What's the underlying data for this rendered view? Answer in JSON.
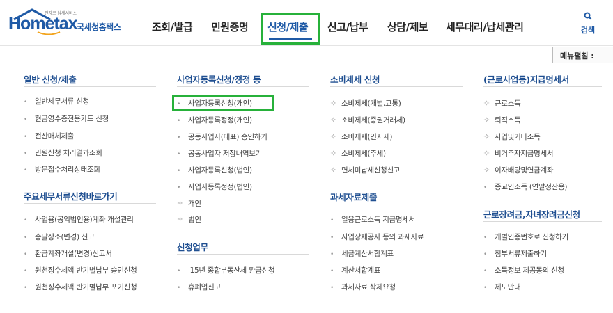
{
  "logo": {
    "tagline": "전자로 납세서비스",
    "main": "Hometax",
    "sub": "국세청홈택스"
  },
  "nav": {
    "items": [
      "조회/발급",
      "민원증명",
      "신청/제출",
      "신고/납부",
      "상담/제보",
      "세무대리/납세관리"
    ],
    "active": "신청/제출",
    "search_label": "검색"
  },
  "menu_collapse_label": "메뉴펼침 :",
  "sections": {
    "general": {
      "title": "일반 신청/제출",
      "items": [
        "일반세무서류 신청",
        "현금영수증전용카드 신청",
        "전산매체제출",
        "민원신청 처리결과조회",
        "방문접수처리상태조회"
      ]
    },
    "major_docs": {
      "title": "주요세무서류신청바로가기",
      "items": [
        "사업용(공익법인용)계좌 개설관리",
        "송달장소(변경) 신고",
        "환급계좌개설(변경)신고서",
        "원천징수세액 반기별납부 승인신청",
        "원천징수세액 반기별납부 포기신청"
      ]
    },
    "biz_reg": {
      "title": "사업자등록신청/정정 등",
      "items": [
        "사업자등록신청(개인)",
        "사업자등록정정(개인)",
        "공동사업자(대표) 승인하기",
        "공동사업자 저장내역보기",
        "사업자등록신청(법인)",
        "사업자등록정정(법인)",
        "개인",
        "법인"
      ]
    },
    "apply_work": {
      "title": "신청업무",
      "items": [
        "'15년 종합부동산세 환급신청",
        "휴폐업신고"
      ]
    },
    "consumption": {
      "title": "소비제세 신청",
      "items": [
        "소비제세(개별,교통)",
        "소비제세(증권거래세)",
        "소비제세(인지세)",
        "소비제세(주세)",
        "면세미납세신청신고"
      ]
    },
    "tax_data": {
      "title": "과세자료제출",
      "items": [
        "일용근로소득 지급명세서",
        "사업장제공자 등의 과세자료",
        "세금계산서합계표",
        "계산서합계표",
        "과세자료 삭제요청"
      ]
    },
    "withholding": {
      "title": "(근로사업등)지급명세서",
      "items": [
        "근로소득",
        "퇴직소득",
        "사업및기타소득",
        "비거주자지급명세서",
        "이자배당및연금계좌",
        "종교인소득 (연말정산용)"
      ]
    },
    "earned_credit": {
      "title": "근로장려금,자녀장려금신청",
      "items": [
        "개별인증번호로 신청하기",
        "첨부서류제출하기",
        "소득정보 제공동의 신청",
        "제도안내"
      ]
    },
    "colors": {
      "accent_green": "#27b13a",
      "brand_blue": "#1f5aa6"
    }
  }
}
